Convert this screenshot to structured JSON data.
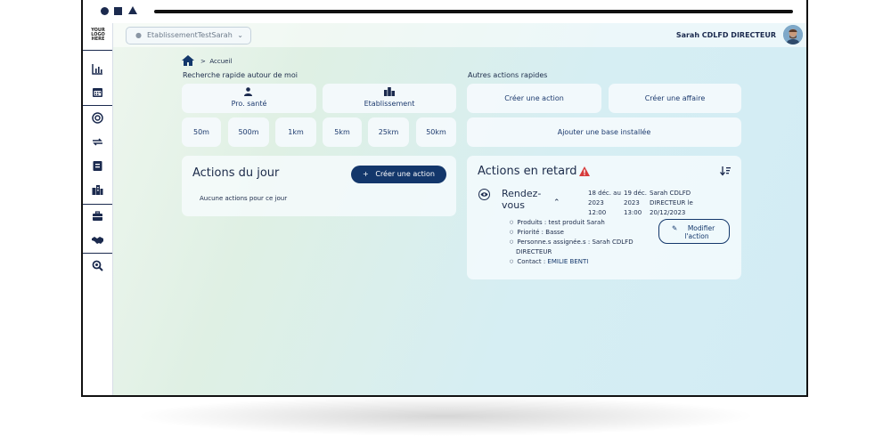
{
  "header": {
    "establishment": "EtablissementTestSarah",
    "user": "Sarah CDLFD DIRECTEUR",
    "logo": "YOUR LOGO HERE"
  },
  "breadcrumb": {
    "home": "Accueil"
  },
  "quick_search": {
    "title": "Recherche rapide autour de moi",
    "pro_label": "Pro. santé",
    "etab_label": "Etablissement",
    "distances": [
      "50m",
      "500m",
      "1km",
      "5km",
      "25km",
      "50km"
    ]
  },
  "other_actions": {
    "title": "Autres actions rapides",
    "create_action": "Créer une action",
    "create_affaire": "Créer une affaire",
    "add_base": "Ajouter une base installée"
  },
  "actions_today": {
    "title": "Actions du jour",
    "create_btn": "Créer une action",
    "empty": "Aucune actions pour ce jour"
  },
  "late_actions": {
    "title": "Actions en retard",
    "type_line1": "Rendez-",
    "type_line2": "vous",
    "start_date": "18 déc. au",
    "start_year": "2023",
    "start_time": "12:00",
    "end_date": "19 déc.",
    "end_year": "2023",
    "end_time": "13:00",
    "owner_line1": "Sarah CDLFD",
    "owner_line2": "DIRECTEUR le",
    "owner_line3": "20/12/2023",
    "details": {
      "produits": "Produits : test produit Sarah",
      "priorite": "Priorité : Basse",
      "personnes_line1": "Personne.s assignée.s : Sarah CDLFD",
      "personnes_line2": "DIRECTEUR",
      "contact_label": "Contact : ",
      "contact_name": "EMILIE BENTI"
    },
    "modify_line1": "Modifier",
    "modify_line2": "l'action"
  },
  "colors": {
    "primary": "#13376b",
    "alert": "#d63b3b"
  }
}
